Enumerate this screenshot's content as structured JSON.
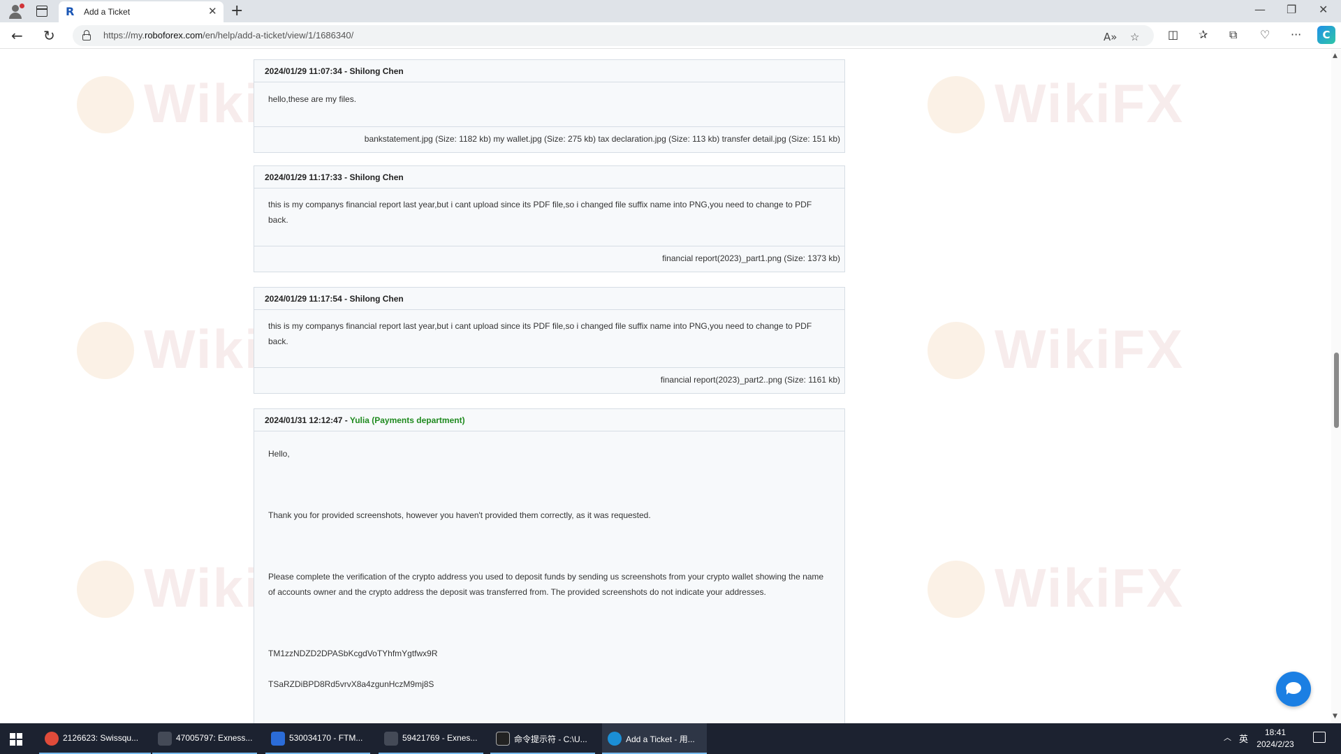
{
  "browser": {
    "tab_title": "Add a Ticket",
    "url_prefix": "https://my.",
    "url_domain": "roboforex.com",
    "url_path": "/en/help/add-a-ticket/view/1/1686340/"
  },
  "tickets": [
    {
      "timestamp": "2024/01/29 11:07:34 - ",
      "author": "Shilong Chen",
      "message": "hello,these are my files.",
      "files": "bankstatement.jpg (Size: 1182 kb) my wallet.jpg (Size: 275 kb) tax declaration.jpg (Size: 113 kb) transfer detail.jpg (Size: 151 kb)"
    },
    {
      "timestamp": "2024/01/29 11:17:33 - ",
      "author": "Shilong Chen",
      "message": "this is my companys  financial report last year,but i cant upload since its PDF file,so i changed  file suffix name into PNG,you need to change to PDF back.",
      "files": "financial report(2023)_part1.png (Size: 1373 kb)"
    },
    {
      "timestamp": "2024/01/29 11:17:54 - ",
      "author": "Shilong Chen",
      "message": "this is my companys  financial report last year,but i cant upload since its PDF file,so i changed  file suffix name into PNG,you need to change to PDF back.",
      "files": "financial report(2023)_part2..png (Size: 1161 kb)"
    },
    {
      "timestamp": "2024/01/31 12:12:47 - ",
      "author": "Yulia (Payments department)",
      "paragraphs": [
        "Hello,",
        "Thank you for provided screenshots, however you haven't provided them correctly, as it was requested.",
        "Please complete the verification of the crypto address you used to deposit funds by sending us screenshots from your crypto wallet showing the name of accounts owner and the crypto address the deposit was transferred from. The provided screenshots do not indicate your addresses.",
        "TM1zzNDZD2DPASbKcgdVoTYhfmYgtfwx9R",
        "TSaRZDiBPD8Rd5vrvX8a4zgunHczM9mj8S"
      ]
    }
  ],
  "watermark_text": "WikiFX",
  "taskbar": {
    "items": [
      {
        "label": "2126623: Swissqu...",
        "icon_color": "#e04b3a"
      },
      {
        "label": "47005797: Exness...",
        "icon_color": "#444a57"
      },
      {
        "label": "530034170 - FTM...",
        "icon_color": "#2b6cd8"
      },
      {
        "label": "59421769 - Exnes...",
        "icon_color": "#444a57"
      },
      {
        "label": "命令提示符 - C:\\U...",
        "icon_color": "#222222"
      },
      {
        "label": "Add a Ticket - 用...",
        "icon_color": "#1b8fd6"
      }
    ],
    "ime": "英",
    "time": "18:41",
    "date": "2024/2/23"
  },
  "colors": {
    "staff_author": "#1f8a1f",
    "accent": "#1b7fe3"
  }
}
